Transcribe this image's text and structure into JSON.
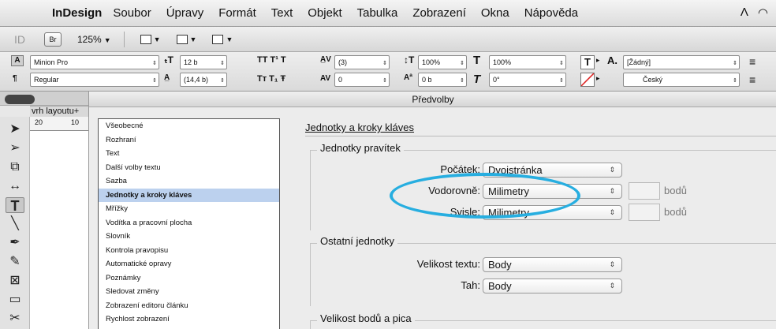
{
  "menubar": {
    "apple_icon": "",
    "app_name": "InDesign",
    "items": [
      "Soubor",
      "Úpravy",
      "Formát",
      "Text",
      "Objekt",
      "Tabulka",
      "Zobrazení",
      "Okna",
      "Nápověda"
    ],
    "status_icons": [
      "adobe-icon",
      "wifi-icon"
    ]
  },
  "appbar": {
    "id_logo": "ID",
    "bridge_label": "Br",
    "zoom": "125%"
  },
  "control": {
    "font_family": "Minion Pro",
    "font_style": "Regular",
    "font_size": "12 b",
    "leading": "(14,4 b)",
    "kerning": "(3)",
    "tracking": "0",
    "vertical_scale": "100%",
    "horizontal_scale": "100%",
    "baseline_shift": "0 b",
    "skew": "0°",
    "char_style": "[Žádný]",
    "language": "Český"
  },
  "document": {
    "tab_label": "vrh layoutu+",
    "ruler_marks": [
      "20",
      "10"
    ]
  },
  "dialog": {
    "title": "Předvolby",
    "nav_items": [
      "Všeobecné",
      "Rozhraní",
      "Text",
      "Další volby textu",
      "Sazba",
      "Jednotky a kroky kláves",
      "Mřížky",
      "Vodítka a pracovní plocha",
      "Slovník",
      "Kontrola pravopisu",
      "Automatické opravy",
      "Poznámky",
      "Sledovat změny",
      "Zobrazení editoru článku",
      "Rychlost zobrazení"
    ],
    "selected_index": 5,
    "section_title": "Jednotky a kroky kláves",
    "ruler_units": {
      "title": "Jednotky pravítek",
      "origin_label": "Počátek:",
      "origin_value": "Dvojstránka",
      "horizontal_label": "Vodorovně:",
      "horizontal_value": "Milimetry",
      "vertical_label": "Svisle:",
      "vertical_value": "Milimetry",
      "unit_points": "bodů"
    },
    "other_units": {
      "title": "Ostatní jednotky",
      "text_size_label": "Velikost textu:",
      "text_size_value": "Body",
      "stroke_label": "Tah:",
      "stroke_value": "Body"
    },
    "point_pica": {
      "title": "Velikost bodů a pica"
    },
    "highlight_color": "#27aee0"
  }
}
